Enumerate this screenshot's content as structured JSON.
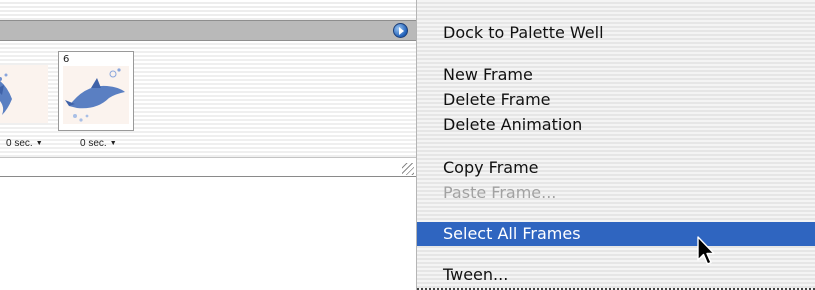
{
  "palette": {
    "frames": [
      {
        "number": "",
        "delay": "0 sec."
      },
      {
        "number": "6",
        "delay": "0 sec."
      }
    ],
    "menu_button_icon": "palette-menu-arrow-icon",
    "resize_icon": "resize-grip-icon"
  },
  "menu": {
    "items": [
      {
        "label": "Dock to Palette Well",
        "enabled": true
      },
      {
        "label": "New Frame",
        "enabled": true
      },
      {
        "label": "Delete Frame",
        "enabled": true
      },
      {
        "label": "Delete Animation",
        "enabled": true
      },
      {
        "label": "Copy Frame",
        "enabled": true
      },
      {
        "label": "Paste Frame...",
        "enabled": false
      },
      {
        "label": "Select All Frames",
        "enabled": true,
        "highlighted": true
      },
      {
        "label": "Tween...",
        "enabled": true
      }
    ],
    "highlight_color": "#2f65c0"
  },
  "pointer_icon": "arrow-cursor-icon"
}
